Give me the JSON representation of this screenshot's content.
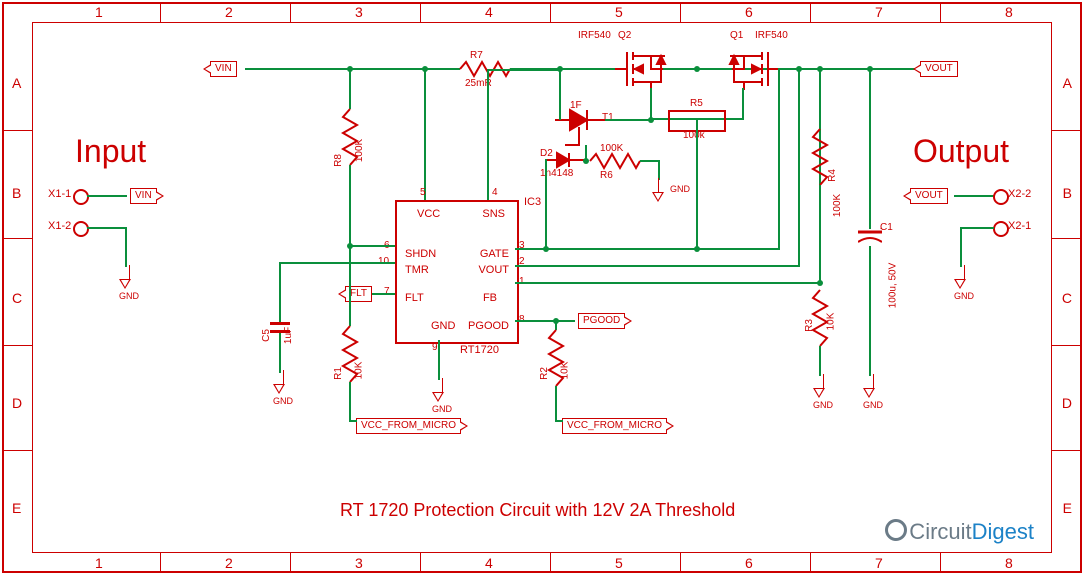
{
  "title": "RT 1720 Protection Circuit with 12V 2A Threshold",
  "section_input": "Input",
  "section_output": "Output",
  "grid": {
    "cols": [
      "1",
      "2",
      "3",
      "4",
      "5",
      "6",
      "7",
      "8"
    ],
    "rows": [
      "A",
      "B",
      "C",
      "D",
      "E"
    ]
  },
  "netlabels": {
    "vin_a": "VIN",
    "vin_b": "VIN",
    "vout_a": "VOUT",
    "vout_b": "VOUT",
    "flt": "FLT",
    "pgood": "PGOOD",
    "vcc_micro_1": "VCC_FROM_MICRO",
    "vcc_micro_2": "VCC_FROM_MICRO"
  },
  "connectors": {
    "x1_1": "X1-1",
    "x1_2": "X1-2",
    "x2_1": "X2-1",
    "x2_2": "X2-2"
  },
  "components": {
    "R1": {
      "ref": "R1",
      "val": "10K"
    },
    "R2": {
      "ref": "R2",
      "val": "10K"
    },
    "R3": {
      "ref": "R3",
      "val": "10K"
    },
    "R4": {
      "ref": "R4",
      "val": "100K"
    },
    "R5": {
      "ref": "R5",
      "val": "100k"
    },
    "R6": {
      "ref": "R6",
      "val": "100K"
    },
    "R7": {
      "ref": "R7",
      "val": "25mR"
    },
    "R8": {
      "ref": "R8",
      "val": "100K"
    },
    "C1": {
      "ref": "C1",
      "val": "100u, 50V"
    },
    "C5": {
      "ref": "C5",
      "val": "1uF"
    },
    "D2": {
      "ref": "D2",
      "val": "1n4148"
    },
    "T1": {
      "ref": "T1",
      "val": "1F"
    },
    "Q1": {
      "ref": "Q1",
      "val": "IRF540"
    },
    "Q2": {
      "ref": "Q2",
      "val": "IRF540"
    }
  },
  "ic": {
    "ref": "IC3",
    "part": "RT1720",
    "pins": {
      "1": "FB",
      "2": "VOUT",
      "3": "GATE",
      "4": "SNS",
      "5": "VCC",
      "6": "SHDN",
      "7": "FLT",
      "8": "PGOOD",
      "9": "GND",
      "10": "TMR"
    }
  },
  "gnd_label": "GND",
  "logo": {
    "a": "C",
    "b": "ircuit",
    "c": "Digest"
  }
}
